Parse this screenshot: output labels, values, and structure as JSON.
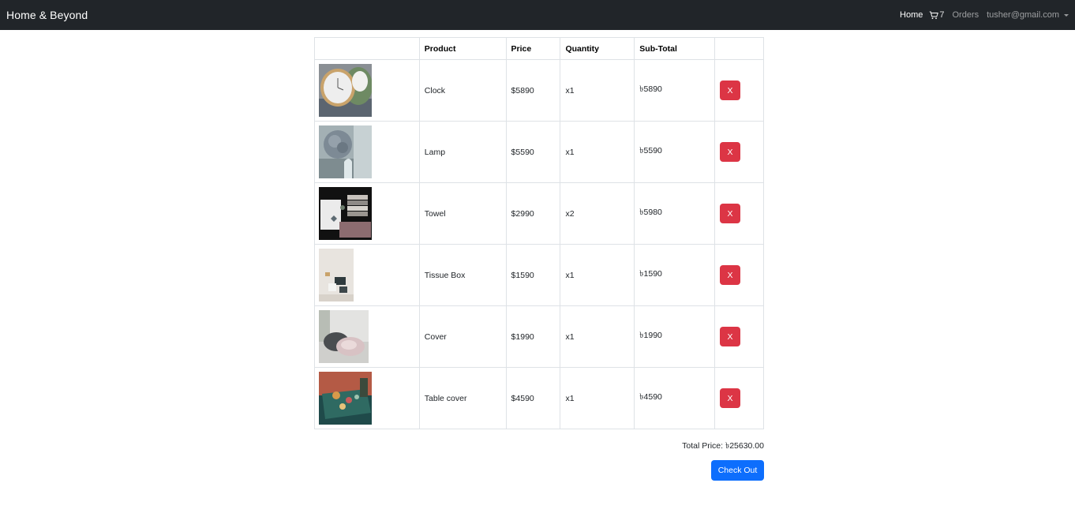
{
  "navbar": {
    "brand": "Home & Beyond",
    "links": {
      "home": "Home",
      "cart_count": "7",
      "orders": "Orders",
      "user": "tusher@gmail.com"
    }
  },
  "table": {
    "headers": [
      "",
      "Product",
      "Price",
      "Quantity",
      "Sub-Total",
      ""
    ],
    "rows": [
      {
        "product": "Clock",
        "price": "$5890",
        "quantity": "x1",
        "subtotal": "৳5890",
        "remove": "X",
        "image": "clock-photo"
      },
      {
        "product": "Lamp",
        "price": "$5590",
        "quantity": "x1",
        "subtotal": "৳5590",
        "remove": "X",
        "image": "lamp-photo"
      },
      {
        "product": "Towel",
        "price": "$2990",
        "quantity": "x2",
        "subtotal": "৳5980",
        "remove": "X",
        "image": "towel-photo"
      },
      {
        "product": "Tissue Box",
        "price": "$1590",
        "quantity": "x1",
        "subtotal": "৳1590",
        "remove": "X",
        "image": "tissue-box-photo"
      },
      {
        "product": "Cover",
        "price": "$1990",
        "quantity": "x1",
        "subtotal": "৳1990",
        "remove": "X",
        "image": "cover-photo"
      },
      {
        "product": "Table cover",
        "price": "$4590",
        "quantity": "x1",
        "subtotal": "৳4590",
        "remove": "X",
        "image": "table-cover-photo"
      }
    ]
  },
  "summary": {
    "total": "Total Price: ৳25630.00",
    "checkout": "Check Out"
  },
  "colors": {
    "navbar_bg": "#212529",
    "danger": "#dc3545",
    "primary": "#0d6efd",
    "border": "#dee2e6"
  }
}
